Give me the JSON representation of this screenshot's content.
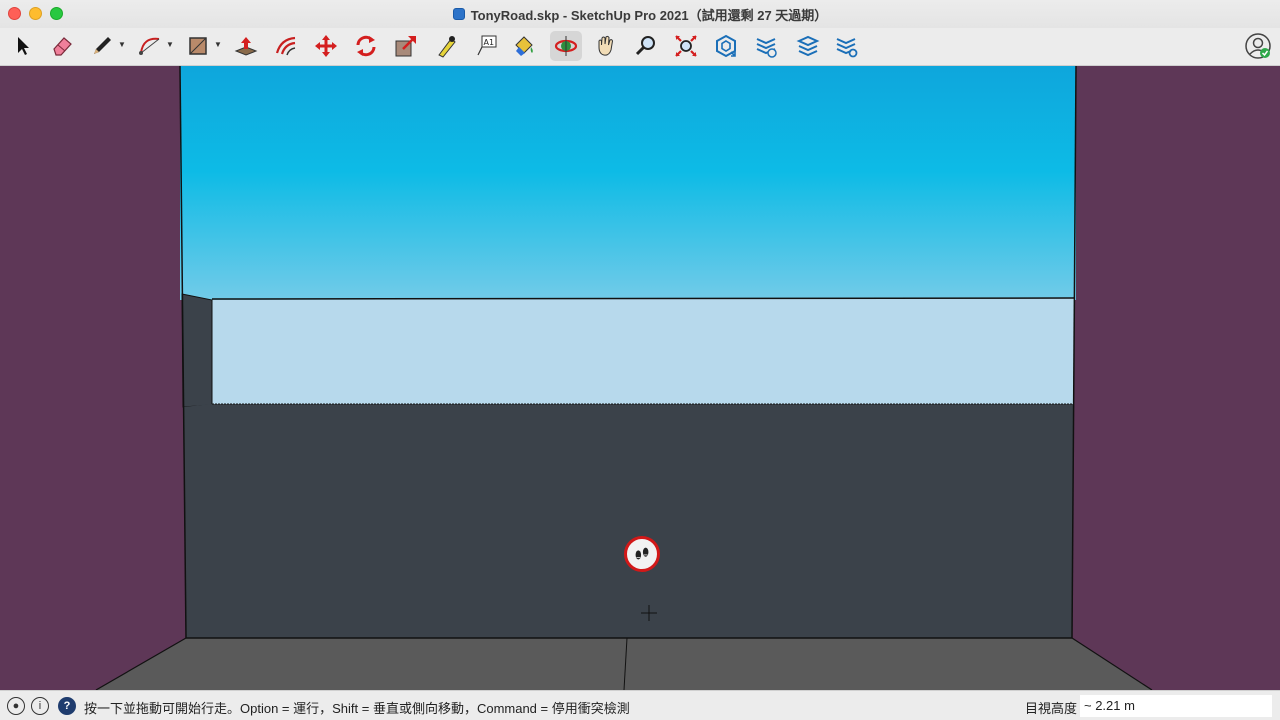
{
  "window": {
    "title": "TonyRoad.skp - SketchUp Pro 2021（試用還剩 27 天過期）"
  },
  "toolbar": {
    "tools": [
      {
        "name": "select-tool",
        "icon": "arrow-cursor-icon"
      },
      {
        "name": "eraser-tool",
        "icon": "eraser-icon"
      },
      {
        "name": "line-tool",
        "icon": "pencil-icon"
      },
      {
        "name": "arc-tool",
        "icon": "arc-icon"
      },
      {
        "name": "rectangle-tool",
        "icon": "rectangle-icon"
      },
      {
        "name": "push-pull-tool",
        "icon": "push-pull-icon"
      },
      {
        "name": "offset-tool",
        "icon": "offset-icon"
      },
      {
        "name": "move-tool",
        "icon": "move-arrows-icon"
      },
      {
        "name": "rotate-tool",
        "icon": "rotate-icon"
      },
      {
        "name": "scale-tool",
        "icon": "scale-icon"
      },
      {
        "name": "tape-measure-tool",
        "icon": "tape-measure-icon"
      },
      {
        "name": "text-tool",
        "icon": "text-a1-icon"
      },
      {
        "name": "paint-bucket-tool",
        "icon": "paint-bucket-icon"
      },
      {
        "name": "orbit-tool",
        "icon": "orbit-icon"
      },
      {
        "name": "pan-tool",
        "icon": "hand-icon"
      },
      {
        "name": "zoom-tool",
        "icon": "magnifier-icon"
      },
      {
        "name": "zoom-extents-tool",
        "icon": "zoom-extents-icon"
      },
      {
        "name": "3d-warehouse",
        "icon": "warehouse-icon"
      },
      {
        "name": "extension-warehouse",
        "icon": "extension-warehouse-icon"
      },
      {
        "name": "layout-send",
        "icon": "layout-icon"
      },
      {
        "name": "extension-manager",
        "icon": "extension-manager-icon"
      }
    ],
    "text_tool_label": "A1"
  },
  "statusbar": {
    "message": "按一下並拖動可開始行走。Option = 運行，Shift = 垂直或側向移動，Command = 停用衝突檢測",
    "eye_height_label": "目視高度",
    "eye_height_value": "~ 2.21 m",
    "help_symbol": "?"
  },
  "colors": {
    "side_walls": "#5e3757",
    "far_wall": "#3b424a",
    "ground": "#5a5a5a",
    "sky_top": "#0ea6dc",
    "sky_bottom": "#72cbe8",
    "haze": "#b7d9ec",
    "cursor_ring": "#d21818"
  }
}
